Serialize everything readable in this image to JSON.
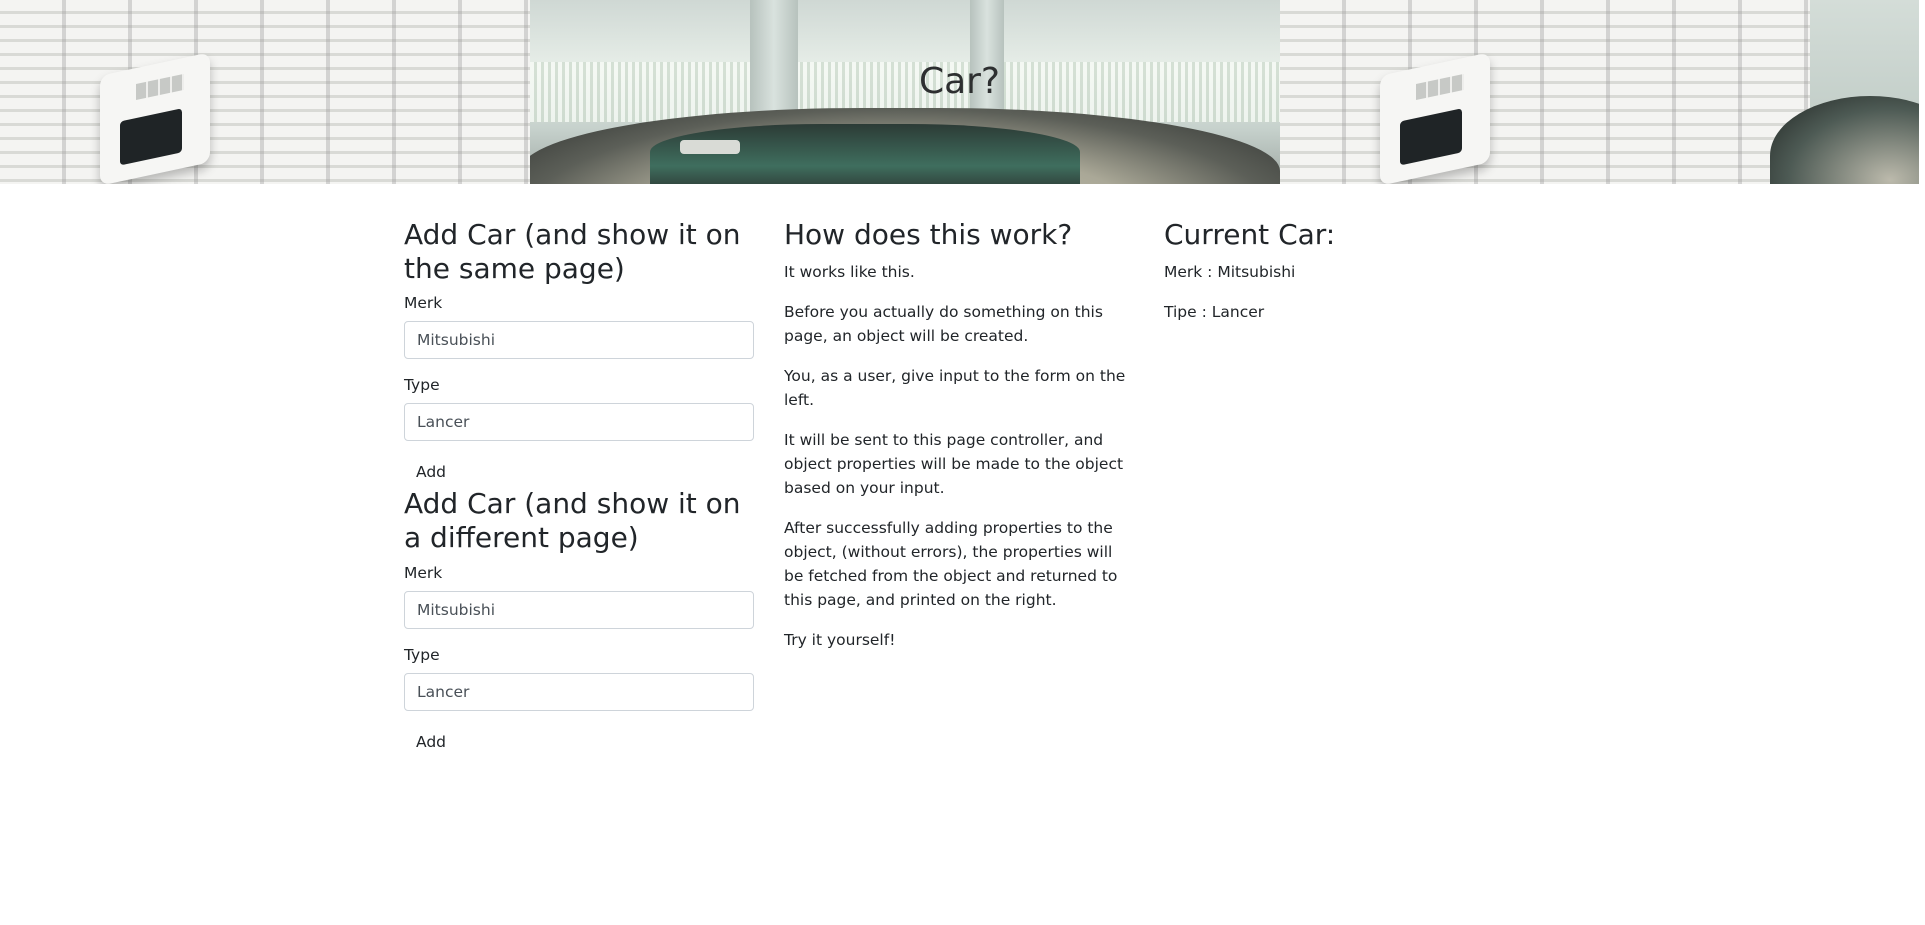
{
  "header": {
    "title": "Car?"
  },
  "form_same_page": {
    "heading": "Add Car (and show it on the same page)",
    "merk_label": "Merk",
    "merk_value": "Mitsubishi",
    "type_label": "Type",
    "type_value": "Lancer",
    "add_label": "Add"
  },
  "form_different_page": {
    "heading": "Add Car (and show it on a different page)",
    "merk_label": "Merk",
    "merk_value": "Mitsubishi",
    "type_label": "Type",
    "type_value": "Lancer",
    "add_label": "Add"
  },
  "how_it_works": {
    "heading": "How does this work?",
    "paragraphs": [
      "It works like this.",
      "Before you actually do something on this page, an object will be created.",
      "You, as a user, give input to the form on the left.",
      "It will be sent to this page controller, and object properties will be made to the object based on your input.",
      "After successfully adding properties to the object, (without errors), the properties will be fetched from the object and returned to this page, and printed on the right.",
      "Try it yourself!"
    ]
  },
  "current_car": {
    "heading": "Current Car:",
    "merk_line": "Merk : Mitsubishi",
    "tipe_line": "Tipe : Lancer"
  }
}
